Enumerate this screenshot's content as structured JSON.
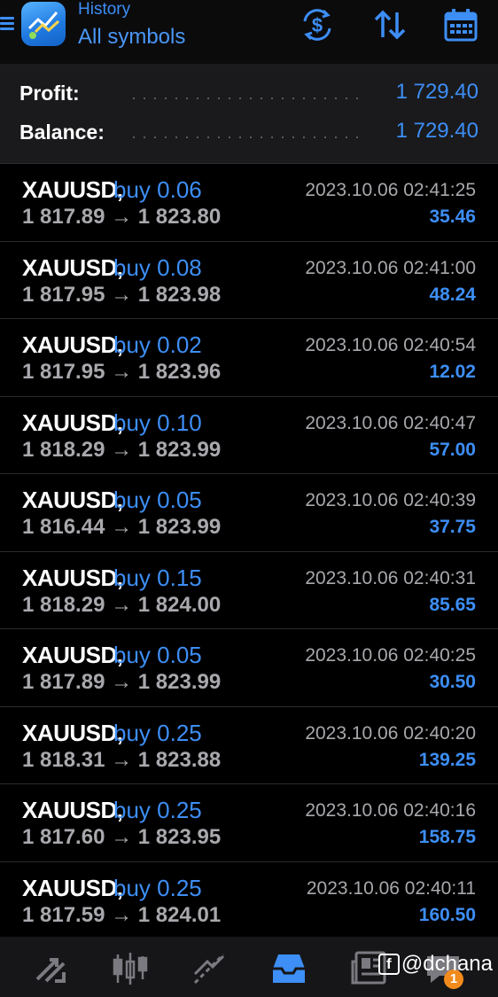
{
  "header": {
    "subtitle": "History",
    "title": "All symbols",
    "icons": [
      "menu-icon",
      "app-logo",
      "currency-exchange-icon",
      "sort-icon",
      "calendar-icon"
    ]
  },
  "summary": {
    "profit_label": "Profit:",
    "profit_value": "1 729.40",
    "balance_label": "Balance:",
    "balance_value": "1 729.40"
  },
  "deals": [
    {
      "symbol": "XAUUSD,",
      "type": "buy 0.06",
      "prices": "1 817.89 → 1 823.80",
      "time": "2023.10.06 02:41:25",
      "profit": "35.46"
    },
    {
      "symbol": "XAUUSD,",
      "type": "buy 0.08",
      "prices": "1 817.95 → 1 823.98",
      "time": "2023.10.06 02:41:00",
      "profit": "48.24"
    },
    {
      "symbol": "XAUUSD,",
      "type": "buy 0.02",
      "prices": "1 817.95 → 1 823.96",
      "time": "2023.10.06 02:40:54",
      "profit": "12.02"
    },
    {
      "symbol": "XAUUSD,",
      "type": "buy 0.10",
      "prices": "1 818.29 → 1 823.99",
      "time": "2023.10.06 02:40:47",
      "profit": "57.00"
    },
    {
      "symbol": "XAUUSD,",
      "type": "buy 0.05",
      "prices": "1 816.44 → 1 823.99",
      "time": "2023.10.06 02:40:39",
      "profit": "37.75"
    },
    {
      "symbol": "XAUUSD,",
      "type": "buy 0.15",
      "prices": "1 818.29 → 1 824.00",
      "time": "2023.10.06 02:40:31",
      "profit": "85.65"
    },
    {
      "symbol": "XAUUSD,",
      "type": "buy 0.05",
      "prices": "1 817.89 → 1 823.99",
      "time": "2023.10.06 02:40:25",
      "profit": "30.50"
    },
    {
      "symbol": "XAUUSD,",
      "type": "buy 0.25",
      "prices": "1 818.31 → 1 823.88",
      "time": "2023.10.06 02:40:20",
      "profit": "139.25"
    },
    {
      "symbol": "XAUUSD,",
      "type": "buy 0.25",
      "prices": "1 817.60 → 1 823.95",
      "time": "2023.10.06 02:40:16",
      "profit": "158.75"
    },
    {
      "symbol": "XAUUSD,",
      "type": "buy 0.25",
      "prices": "1 817.59 → 1 824.01",
      "time": "2023.10.06 02:40:11",
      "profit": "160.50"
    }
  ],
  "bottom_nav": {
    "items": [
      "quotes-icon",
      "chart-icon",
      "trade-icon",
      "history-icon",
      "news-icon",
      "messages-icon"
    ],
    "active": "history-icon",
    "badge": "1"
  },
  "watermark": "@dchana",
  "colors": {
    "accent": "#3d8ef5",
    "background": "#000000",
    "panel": "#1a1a1c",
    "muted": "#a8a8ad"
  }
}
